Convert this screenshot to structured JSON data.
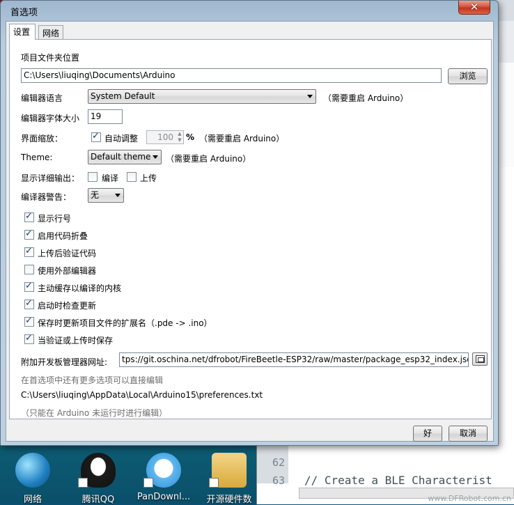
{
  "dialog": {
    "title": "首选项",
    "tabs": [
      {
        "label": "设置"
      },
      {
        "label": "网络"
      }
    ],
    "sketchbook_label": "项目文件夹位置",
    "sketchbook_path": "C:\\Users\\liuqing\\Documents\\Arduino",
    "browse_button": "浏览",
    "language_label": "编辑器语言",
    "language_value": "System Default",
    "restart_note": "（需要重启 Arduino）",
    "font_size_label": "编辑器字体大小",
    "font_size_value": "19",
    "scale_label": "界面缩放：",
    "scale_auto_label": "自动调整",
    "scale_value": "100",
    "scale_unit": "%",
    "theme_label": "Theme:",
    "theme_value": "Default theme",
    "verbose_label": "显示详细输出：",
    "verbose_compile_label": "编译",
    "verbose_upload_label": "上传",
    "warnings_label": "编译器警告：",
    "warnings_value": "无",
    "options": [
      {
        "label": "显示行号",
        "checked": true
      },
      {
        "label": "启用代码折叠",
        "checked": true
      },
      {
        "label": "上传后验证代码",
        "checked": true
      },
      {
        "label": "使用外部编辑器",
        "checked": false
      },
      {
        "label": "主动缓存以编译的内核",
        "checked": true
      },
      {
        "label": "启动时检查更新",
        "checked": true
      },
      {
        "label": "保存时更新项目文件的扩展名（.pde -> .ino）",
        "checked": true
      },
      {
        "label": "当验证或上传时保存",
        "checked": true
      }
    ],
    "board_urls_label": "附加开发板管理器网址:",
    "board_urls_value": "tps://git.oschina.net/dfrobot/FireBeetle-ESP32/raw/master/package_esp32_index.json",
    "more_prefs_note": "在首选项中还有更多选项可以直接编辑",
    "prefs_path": "C:\\Users\\liuqing\\AppData\\Local\\Arduino15\\preferences.txt",
    "edit_note": "（只能在 Arduino 未运行时进行编辑）",
    "ok_button": "好",
    "cancel_button": "取消"
  },
  "desktop_icons": [
    {
      "label": "网络",
      "icon": "network-icon"
    },
    {
      "label": "腾讯QQ",
      "icon": "qq-icon"
    },
    {
      "label": "PanDownl...",
      "icon": "cloud-icon"
    },
    {
      "label": "开源硬件数",
      "icon": "folder-icon"
    }
  ],
  "editor": {
    "line_numbers": [
      "62",
      "63"
    ],
    "line_63_code": "// Create a BLE Characterist",
    "watermark": "www.DFRobot.com.cn"
  },
  "colors": {
    "title_bar": "#b9cde0",
    "close_button": "#c4331a",
    "check_mark": "#1f3d6b"
  }
}
